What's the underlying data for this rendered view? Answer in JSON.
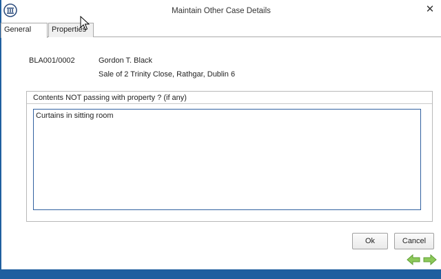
{
  "window": {
    "title": "Maintain Other Case Details"
  },
  "icons": {
    "app": "app-logo-icon",
    "close": "close-icon",
    "prev": "arrow-left-icon",
    "next": "arrow-right-icon"
  },
  "tabs": [
    {
      "label": "General",
      "active": true
    },
    {
      "label": "Properties",
      "active": false
    }
  ],
  "case": {
    "reference": "BLA001/0002",
    "client_name": "Gordon T. Black",
    "description": "Sale of 2 Trinity Close, Rathgar, Dublin 6"
  },
  "contents_group": {
    "header": "Contents NOT passing with property ? (if any)",
    "value": "Curtains in sitting room"
  },
  "buttons": {
    "ok": "Ok",
    "cancel": "Cancel"
  },
  "colors": {
    "accent": "#1f5f9f",
    "nav_arrow": "#7bc043"
  }
}
